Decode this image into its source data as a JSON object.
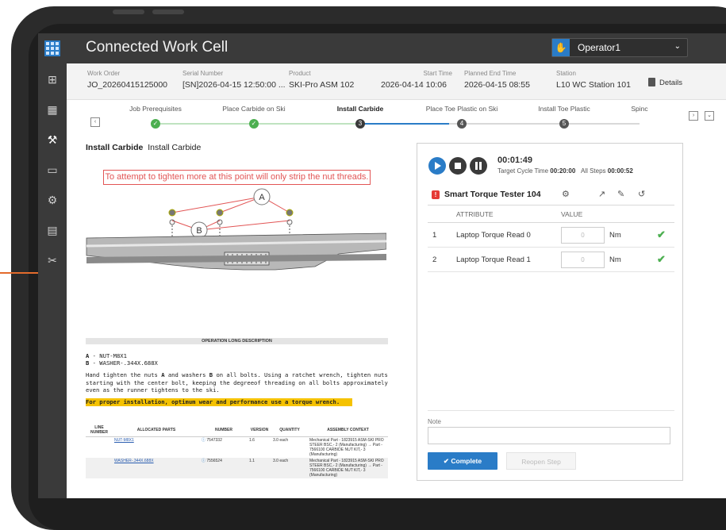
{
  "app": {
    "title": "Connected Work Cell",
    "operator": "Operator1"
  },
  "header": {
    "fields": [
      {
        "label": "Work Order",
        "value": "JO_20260415125000"
      },
      {
        "label": "Serial Number",
        "value": "[SN]2026-04-15 12:50:00 ..."
      },
      {
        "label": "Product",
        "value": "SKI-Pro ASM 102"
      },
      {
        "label": "Start Time",
        "value": "2026-04-14 10:06"
      },
      {
        "label": "Planned End Time",
        "value": "2026-04-15 08:55"
      },
      {
        "label": "Station",
        "value": "L10 WC Station 101"
      }
    ],
    "details_label": "Details"
  },
  "steps": [
    {
      "label": "Job Prerequisites",
      "marker": "✓"
    },
    {
      "label": "Place Carbide on Ski",
      "marker": "✓"
    },
    {
      "label": "Install Carbide",
      "marker": "3"
    },
    {
      "label": "Place Toe Plastic on Ski",
      "marker": "4"
    },
    {
      "label": "Install Toe Plastic",
      "marker": "5"
    },
    {
      "label": "Spinc",
      "marker": ""
    }
  ],
  "instruction": {
    "title_bold": "Install Carbide",
    "title_sub": "Install Carbide",
    "warning": "To attempt to tighten more at this point will only strip the nut threads.",
    "callout_a": "A",
    "callout_b": "B",
    "op_desc_header": "OPERATION LONG DESCRIPTION",
    "legend_a_key": "A",
    "legend_a_text": " - NUT-M8X1",
    "legend_b_key": "B",
    "legend_b_text": " - WASHER-.344X.688X",
    "body_1": "Hand tighten the nuts ",
    "body_a": "A",
    "body_2": " and washers ",
    "body_b": "B",
    "body_3": " on all bolts. Using a ratchet wrench, tighten nuts starting with the center bolt, keeping the degreeof threading on all bolts approximately even as the runner tightens to the ski.",
    "highlight": "For proper installation, optimum wear and performance use a torque wrench.",
    "table_headers": [
      "LINE NUMBER",
      "ALLOCATED PARTS",
      "NUMBER",
      "VERSION",
      "QUANTITY",
      "ASSEMBLY CONTEXT"
    ],
    "table_rows": [
      {
        "line": "",
        "part": "NUT-M8X1",
        "number": "7547332",
        "version": "1.6",
        "quantity": "3.0 each",
        "context": "Mechanical Part - 1823915 ASM-SKI PRO STEER BSC,- 2 (Manufacturing) → Part - 7566100 CARBIDE NUT KIT,- 3 (Manufacturing)"
      },
      {
        "line": "",
        "part": "WASHER-.344X.688X",
        "number": "7556524",
        "version": "1.1",
        "quantity": "3.0 each",
        "context": "Mechanical Part - 1823915 ASM-SKI PRO STEER BSC,- 2 (Manufacturing) → Part - 7566100 CARBIDE NUT KIT,- 3 (Manufacturing)"
      }
    ]
  },
  "panel": {
    "timer": "00:01:49",
    "cycle_label": "Target Cycle Time",
    "cycle_value": "00:20:00",
    "all_steps_label": "All Steps",
    "all_steps_value": "00:00:52",
    "tool_name": "Smart Torque Tester 104",
    "columns": [
      "ATTRIBUTE",
      "VALUE"
    ],
    "rows": [
      {
        "index": "1",
        "attribute": "Laptop Torque Read 0",
        "value": "0",
        "unit": "Nm"
      },
      {
        "index": "2",
        "attribute": "Laptop Torque Read 1",
        "value": "0",
        "unit": "Nm"
      }
    ],
    "note_label": "Note",
    "complete_label": "Complete",
    "reopen_label": "Reopen Step"
  },
  "colors": {
    "accent": "#2a7cc7",
    "topbar": "#3a3a3a",
    "success": "#4caf50",
    "warning": "#e25555",
    "highlight": "#f5c200"
  },
  "icons": [
    "grid-menu-icon",
    "hand-icon",
    "chevron-down-icon",
    "dashboard-icon",
    "calendar-icon",
    "workstation-icon",
    "monitor-icon",
    "robot-icon",
    "report-icon",
    "tools-icon",
    "document-icon",
    "gear-icon",
    "edit-icon",
    "pencil-icon",
    "history-icon",
    "checkmark-icon",
    "info-icon"
  ]
}
